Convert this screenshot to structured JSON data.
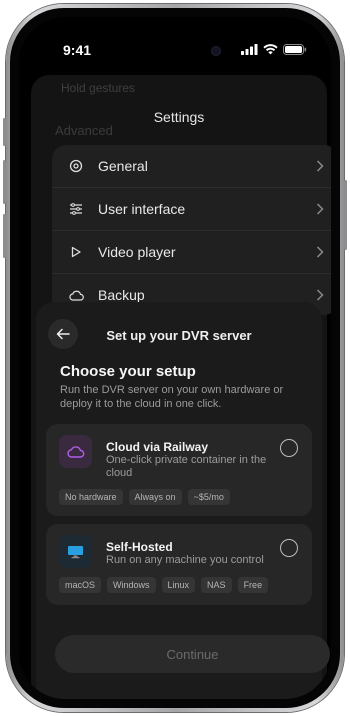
{
  "status_bar": {
    "time": "9:41"
  },
  "background_screen": {
    "ghost_row_text": "Hold gestures",
    "title": "Settings",
    "section_label": "Advanced",
    "items": [
      {
        "label": "General",
        "icon": "gear-icon"
      },
      {
        "label": "User interface",
        "icon": "sliders-icon"
      },
      {
        "label": "Video player",
        "icon": "play-icon"
      },
      {
        "label": "Backup",
        "icon": "cloud-icon"
      }
    ]
  },
  "modal": {
    "title": "Set up your DVR server",
    "heading": "Choose your setup",
    "description": "Run the DVR server on your own hardware or deploy it to the cloud in one click.",
    "options": [
      {
        "title": "Cloud via Railway",
        "description": "One-click private container in the cloud",
        "icon": "cloud-icon",
        "tags": [
          "No hardware",
          "Always on",
          "~$5/mo"
        ],
        "selected": false
      },
      {
        "title": "Self-Hosted",
        "description": "Run on any machine you control",
        "icon": "monitor-icon",
        "tags": [
          "macOS",
          "Windows",
          "Linux",
          "NAS",
          "Free"
        ],
        "selected": false
      }
    ],
    "continue_label": "Continue"
  },
  "colors": {
    "accent_cloud": "#b25de8",
    "accent_monitor": "#2a9fe0",
    "background": "#000000",
    "card": "#272727"
  }
}
